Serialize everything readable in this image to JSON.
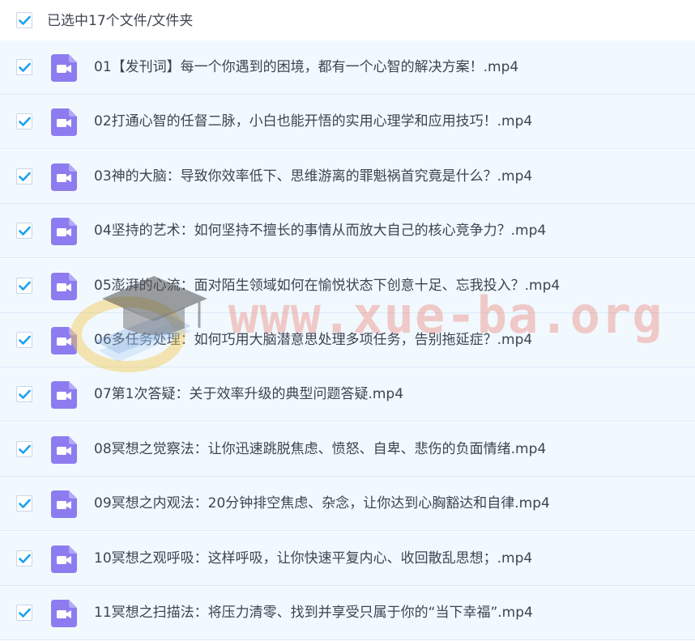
{
  "selection_summary": "已选中17个文件/文件夹",
  "colors": {
    "checkbox_check": "#1aa1f0",
    "video_icon": "#8c7cf0",
    "row_background": "#f1f9ff",
    "text": "#3d4451"
  },
  "icons": {
    "select_all": "checkbox-checked-icon",
    "row_checkbox": "checkbox-checked-icon",
    "file_type": "video-file-icon"
  },
  "watermark": {
    "text": "www.xue-ba.org"
  },
  "files": [
    {
      "name": "01【发刊词】每一个你遇到的困境，都有一个心智的解决方案！.mp4",
      "checked": true
    },
    {
      "name": "02打通心智的任督二脉，小白也能开悟的实用心理学和应用技巧！.mp4",
      "checked": true
    },
    {
      "name": "03神的大脑：导致你效率低下、思维游离的罪魁祸首究竟是什么？.mp4",
      "checked": true
    },
    {
      "name": "04坚持的艺术：如何坚持不擅长的事情从而放大自己的核心竞争力？.mp4",
      "checked": true
    },
    {
      "name": "05澎湃的心流：面对陌生领域如何在愉悦状态下创意十足、忘我投入？.mp4",
      "checked": true
    },
    {
      "name": "06多任务处理：如何巧用大脑潜意思处理多项任务，告别拖延症？.mp4",
      "checked": true
    },
    {
      "name": "07第1次答疑：关于效率升级的典型问题答疑.mp4",
      "checked": true
    },
    {
      "name": "08冥想之觉察法：让你迅速跳脱焦虑、愤怒、自卑、悲伤的负面情绪.mp4",
      "checked": true
    },
    {
      "name": "09冥想之内观法：20分钟排空焦虑、杂念，让你达到心胸豁达和自律.mp4",
      "checked": true
    },
    {
      "name": "10冥想之观呼吸：这样呼吸，让你快速平复内心、收回散乱思想；.mp4",
      "checked": true
    },
    {
      "name": "11冥想之扫描法：将压力清零、找到并享受只属于你的“当下幸福”.mp4",
      "checked": true
    }
  ]
}
